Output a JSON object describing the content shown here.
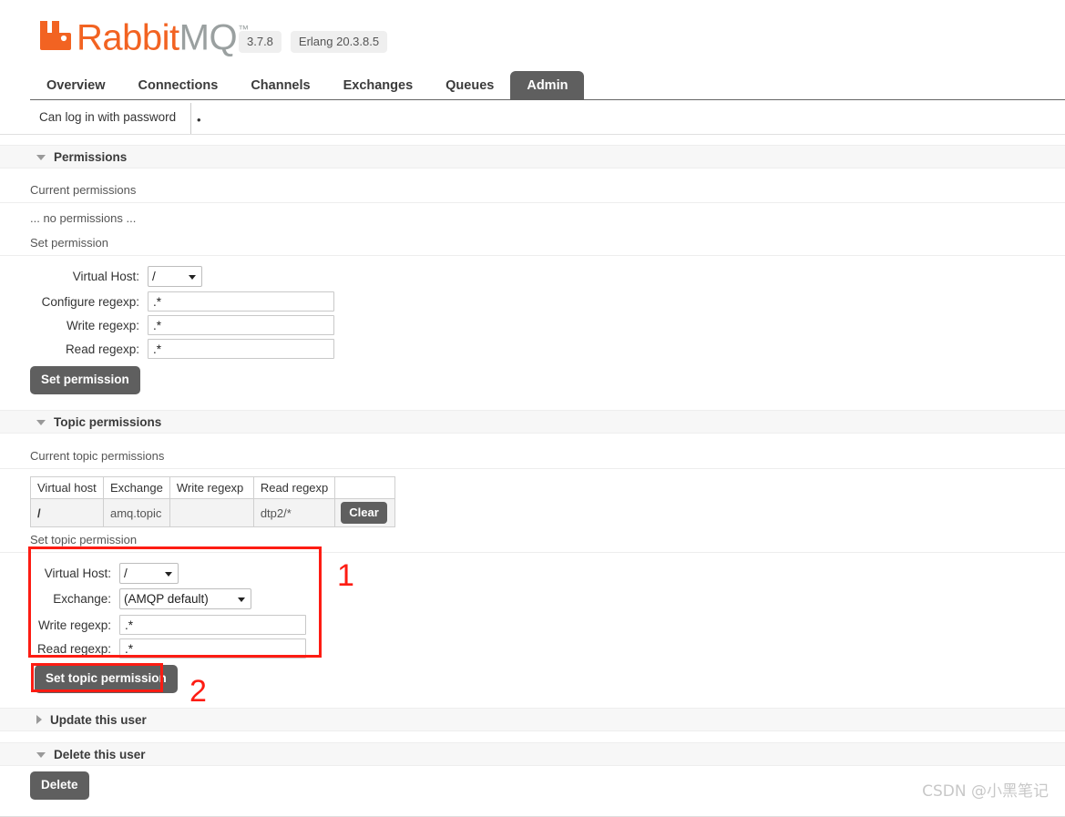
{
  "header": {
    "logo_rabbit": "Rabbit",
    "logo_mq": "MQ",
    "logo_tm": "™",
    "version": "3.7.8",
    "erlang_version": "Erlang 20.3.8.5"
  },
  "nav": {
    "tabs": [
      {
        "label": "Overview",
        "active": false
      },
      {
        "label": "Connections",
        "active": false
      },
      {
        "label": "Channels",
        "active": false
      },
      {
        "label": "Exchanges",
        "active": false
      },
      {
        "label": "Queues",
        "active": false
      },
      {
        "label": "Admin",
        "active": true
      }
    ]
  },
  "user_info": {
    "label": "Can log in with password",
    "value": "•"
  },
  "permissions": {
    "section_title": "Permissions",
    "current_label": "Current permissions",
    "empty_text": "... no permissions ...",
    "set_label": "Set permission",
    "form": {
      "vhost_label": "Virtual Host:",
      "vhost_value": "/",
      "configure_label": "Configure regexp:",
      "configure_value": ".*",
      "write_label": "Write regexp:",
      "write_value": ".*",
      "read_label": "Read regexp:",
      "read_value": ".*",
      "submit_label": "Set permission"
    }
  },
  "topic_permissions": {
    "section_title": "Topic permissions",
    "current_label": "Current topic permissions",
    "table": {
      "columns": [
        "Virtual host",
        "Exchange",
        "Write regexp",
        "Read regexp",
        ""
      ],
      "rows": [
        {
          "virtual_host": "/",
          "exchange": "amq.topic",
          "write_regexp": "",
          "read_regexp": "dtp2/*",
          "action_label": "Clear"
        }
      ]
    },
    "set_label": "Set topic permission",
    "form": {
      "vhost_label": "Virtual Host:",
      "vhost_value": "/",
      "exchange_label": "Exchange:",
      "exchange_value": "(AMQP default)",
      "write_label": "Write regexp:",
      "write_value": ".*",
      "read_label": "Read regexp:",
      "read_value": ".*",
      "submit_label": "Set topic permission"
    }
  },
  "update_user": {
    "section_title": "Update this user"
  },
  "delete_user": {
    "section_title": "Delete this user",
    "delete_label": "Delete"
  },
  "annotations": {
    "step_one": "1",
    "step_two": "2",
    "color": "#fd1c13"
  },
  "watermark": {
    "text": "CSDN @小黑笔记"
  }
}
